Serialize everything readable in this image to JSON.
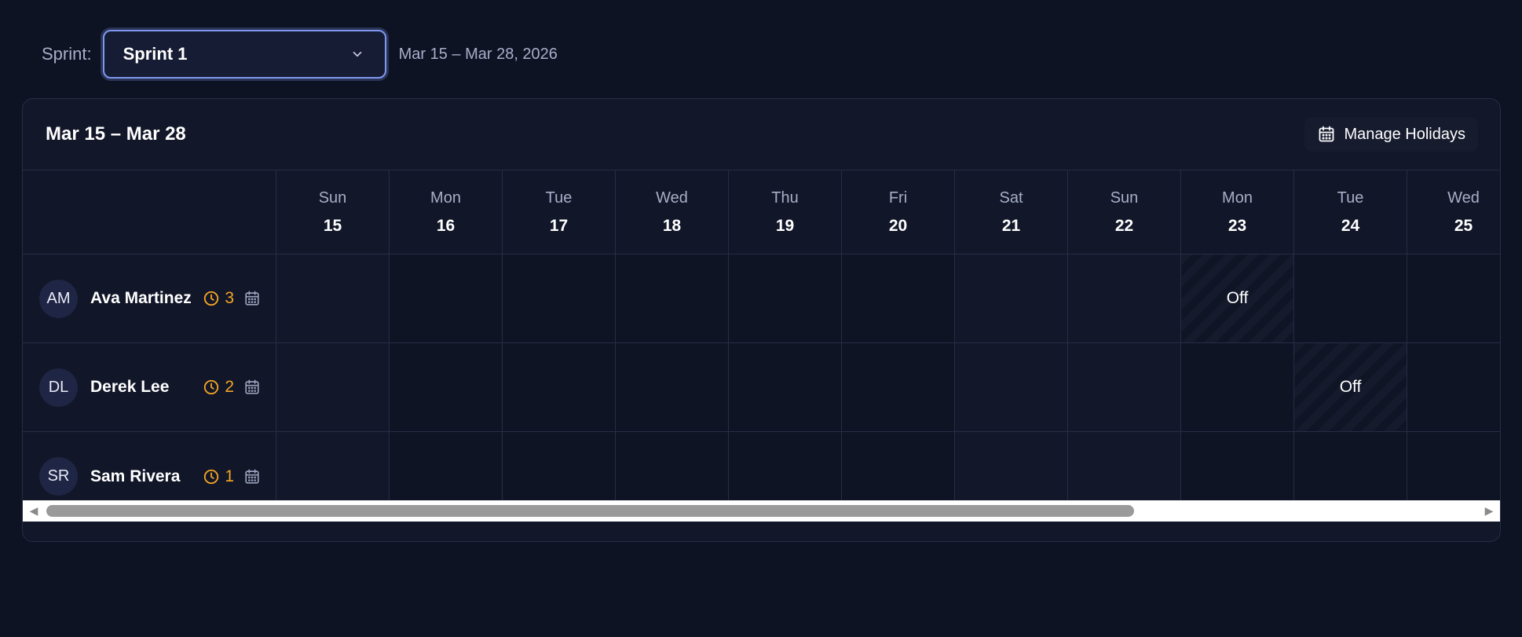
{
  "toolbar": {
    "sprint_label": "Sprint:",
    "selected_sprint": "Sprint 1",
    "range": "Mar 15 – Mar 28, 2026"
  },
  "panel": {
    "title": "Mar 15 – Mar 28",
    "manage_holidays_label": "Manage Holidays"
  },
  "days": [
    {
      "name": "Sun",
      "num": "15"
    },
    {
      "name": "Mon",
      "num": "16"
    },
    {
      "name": "Tue",
      "num": "17"
    },
    {
      "name": "Wed",
      "num": "18"
    },
    {
      "name": "Thu",
      "num": "19"
    },
    {
      "name": "Fri",
      "num": "20"
    },
    {
      "name": "Sat",
      "num": "21"
    },
    {
      "name": "Sun",
      "num": "22"
    },
    {
      "name": "Mon",
      "num": "23"
    },
    {
      "name": "Tue",
      "num": "24"
    },
    {
      "name": "Wed",
      "num": "25"
    }
  ],
  "people": [
    {
      "initials": "AM",
      "name": "Ava Martinez",
      "count": "3"
    },
    {
      "initials": "DL",
      "name": "Derek Lee",
      "count": "2"
    },
    {
      "initials": "SR",
      "name": "Sam Rivera",
      "count": "1"
    }
  ],
  "off_label": "Off",
  "icons": {
    "dropdown": "chevron-down-icon",
    "holidays": "calendar-icon",
    "pending": "clock-icon",
    "schedule": "calendar-icon"
  },
  "colors": {
    "accent": "#7f97ef",
    "pending": "#f5a524"
  }
}
